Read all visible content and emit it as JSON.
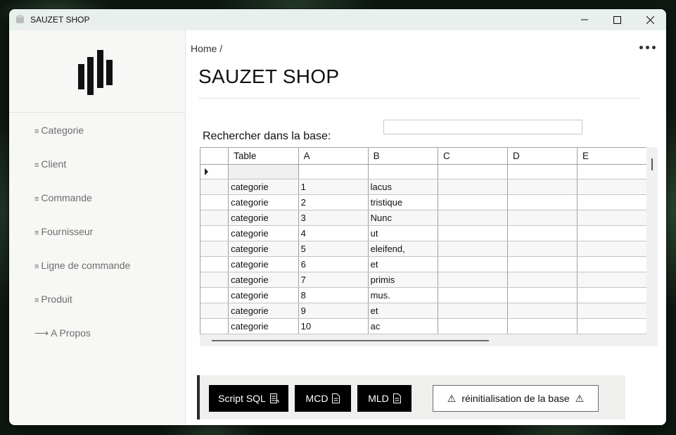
{
  "window": {
    "title": "SAUZET SHOP",
    "controls": {
      "minimize": "minimize",
      "maximize": "maximize",
      "close": "close"
    }
  },
  "sidebar": {
    "logo": "bar-logo",
    "items": [
      {
        "glyph": "≡",
        "label": "Categorie"
      },
      {
        "glyph": "≡",
        "label": "Client"
      },
      {
        "glyph": "≡",
        "label": "Commande"
      },
      {
        "glyph": "≡",
        "label": "Fournisseur"
      },
      {
        "glyph": "≡",
        "label": "Ligne de commande"
      },
      {
        "glyph": "≡",
        "label": "Produit"
      },
      {
        "glyph": "⟶",
        "label": "A Propos"
      }
    ]
  },
  "header": {
    "breadcrumb": "Home /",
    "title": "SAUZET SHOP"
  },
  "search": {
    "label": "Rechercher dans la base:",
    "value": "",
    "placeholder": ""
  },
  "grid": {
    "columns": [
      "Table",
      "A",
      "B",
      "C",
      "D",
      "E"
    ],
    "rows": [
      [
        "categorie",
        "1",
        "lacus",
        "",
        "",
        ""
      ],
      [
        "categorie",
        "2",
        "tristique",
        "",
        "",
        ""
      ],
      [
        "categorie",
        "3",
        "Nunc",
        "",
        "",
        ""
      ],
      [
        "categorie",
        "4",
        "ut",
        "",
        "",
        ""
      ],
      [
        "categorie",
        "5",
        "eleifend,",
        "",
        "",
        ""
      ],
      [
        "categorie",
        "6",
        "et",
        "",
        "",
        ""
      ],
      [
        "categorie",
        "7",
        "primis",
        "",
        "",
        ""
      ],
      [
        "categorie",
        "8",
        "mus.",
        "",
        "",
        ""
      ],
      [
        "categorie",
        "9",
        "et",
        "",
        "",
        ""
      ],
      [
        "categorie",
        "10",
        "ac",
        "",
        "",
        ""
      ]
    ]
  },
  "actions": {
    "script_sql": "Script SQL",
    "mcd": "MCD",
    "mld": "MLD",
    "reset": "réinitialisation de la base",
    "warning_glyph": "⚠"
  },
  "colors": {
    "titlebar": "#e8efec",
    "sidebar_bg": "#f7f7f5",
    "button_dark": "#000000",
    "accent_bar": "#2b2b2b"
  }
}
